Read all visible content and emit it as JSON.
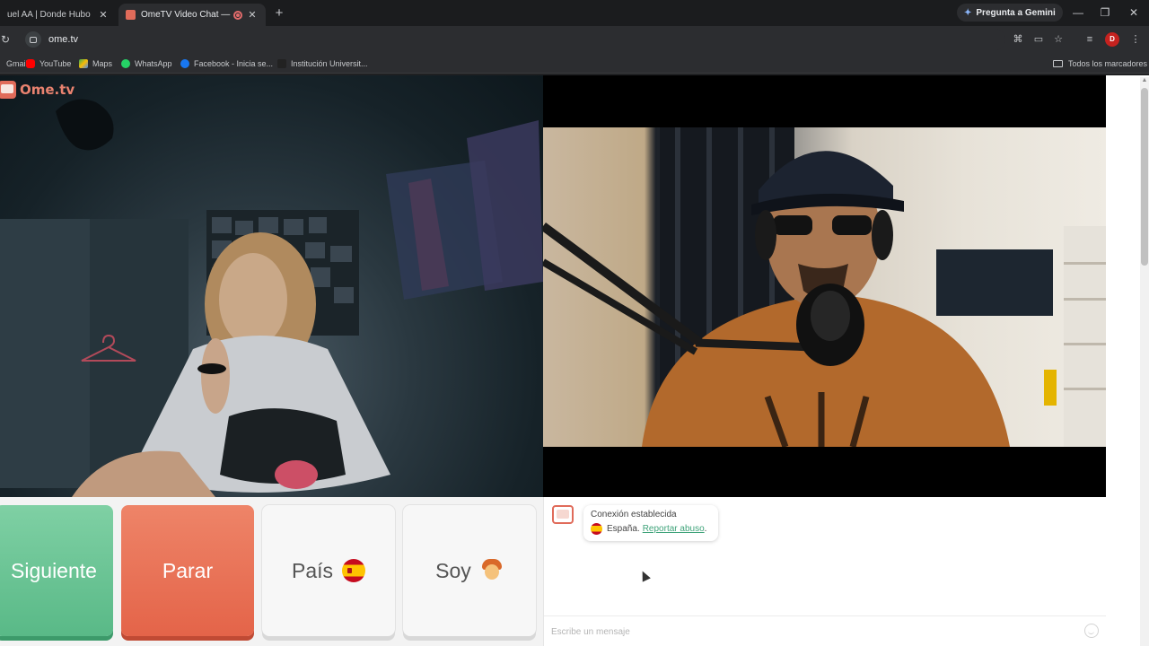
{
  "browser": {
    "tabs": [
      {
        "title": "uel AA | Donde Hubo Fuego",
        "active": false
      },
      {
        "title": "OmeTV Video Chat — Ome",
        "active": true
      }
    ],
    "new_tab": "+",
    "gemini_button": "Pregunta a Gemini",
    "url": "ome.tv",
    "profile_initial": "D",
    "window_controls": {
      "minimize": "—",
      "restore": "❐",
      "close": "✕"
    },
    "bookmarks": [
      {
        "label": "Gmail",
        "icon": "gmail-icon"
      },
      {
        "label": "YouTube",
        "icon": "youtube-icon"
      },
      {
        "label": "Maps",
        "icon": "maps-icon"
      },
      {
        "label": "WhatsApp",
        "icon": "whatsapp-icon"
      },
      {
        "label": "Facebook - Inicia se...",
        "icon": "facebook-icon"
      },
      {
        "label": "Institución Universit...",
        "icon": "institution-icon"
      }
    ],
    "all_bookmarks": "Todos los marcadores"
  },
  "page": {
    "logo_text": "Ome.tv",
    "buttons": {
      "next": "Siguiente",
      "stop": "Parar",
      "country": "País",
      "gender": "Soy"
    },
    "chat": {
      "status_title": "Conexión establecida",
      "country": "España.",
      "report_link": "Reportar abuso",
      "report_suffix": ".",
      "input_placeholder": "Escribe un mensaje"
    }
  },
  "colors": {
    "next_button": "#6cc596",
    "stop_button": "#e8725a",
    "brand": "#e06b5a",
    "link": "#3fa37a"
  }
}
